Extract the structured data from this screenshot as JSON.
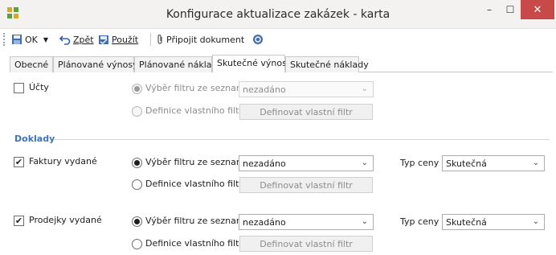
{
  "window": {
    "title": "Konfigurace aktualizace zakázek - karta",
    "minimize_glyph": "–",
    "maximize_glyph": "☐",
    "close_glyph": "✕"
  },
  "toolbar": {
    "ok_label": "OK",
    "back_label": "Zpět",
    "apply_label": "Použít",
    "attach_label": "Připojit dokument",
    "help_icon": "help-icon"
  },
  "tabs": [
    {
      "label": "Obecné",
      "active": false
    },
    {
      "label": "Plánované výnosy",
      "active": false
    },
    {
      "label": "Plánované náklady",
      "active": false
    },
    {
      "label": "Skutečné výnosy",
      "active": true
    },
    {
      "label": "Skutečné náklady",
      "active": false
    }
  ],
  "ucty": {
    "label": "Účty",
    "checked": false,
    "radio_filter_label": "Výběr filtru ze seznamu",
    "select_value": "nezadáno",
    "radio_custom_label": "Definice vlastního filtru",
    "custom_button": "Definovat vlastní filtr"
  },
  "doklady_section": "Doklady",
  "faktury": {
    "label": "Faktury vydané",
    "checked": true,
    "radio_filter_label": "Výběr filtru ze seznamu",
    "select_value": "nezadáno",
    "radio_custom_label": "Definice vlastního filtru",
    "custom_button": "Definovat vlastní filtr",
    "price_label": "Typ ceny",
    "price_value": "Skutečná"
  },
  "prodejky": {
    "label": "Prodejky vydané",
    "checked": true,
    "radio_filter_label": "Výběr filtru ze seznamu",
    "select_value": "nezadáno",
    "radio_custom_label": "Definice vlastního filtru",
    "custom_button": "Definovat vlastní filtr",
    "price_label": "Typ ceny",
    "price_value": "Skutečná"
  },
  "check_glyph": "✔",
  "chevron_glyph": "⌄"
}
